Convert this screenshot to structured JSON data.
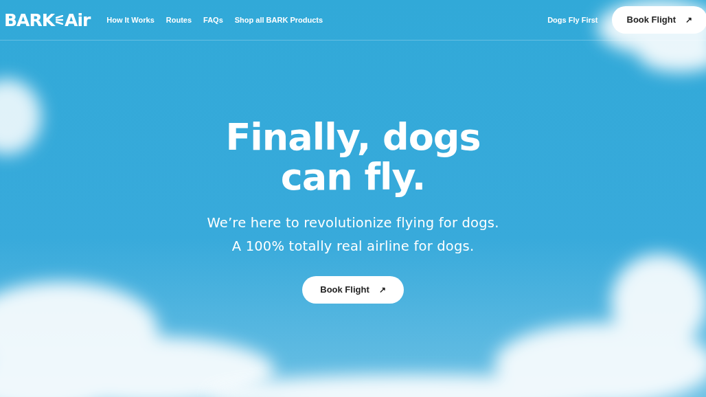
{
  "logo": {
    "part_1": "BARK",
    "part_2": "Air"
  },
  "nav_links": [
    "How It Works",
    "Routes",
    "FAQs",
    "Shop all BARK Products"
  ],
  "nav_right": {
    "link": "Dogs Fly First",
    "button": "Book Flight",
    "button_icon": "↗"
  },
  "hero": {
    "headline_lines": [
      "Finally, dogs",
      "can fly."
    ],
    "subtitle_lines": [
      "We’re here to revolutionize flying for dogs.",
      "A 100% totally real airline for dogs."
    ],
    "button": "Book Flight",
    "button_icon": "↗"
  }
}
